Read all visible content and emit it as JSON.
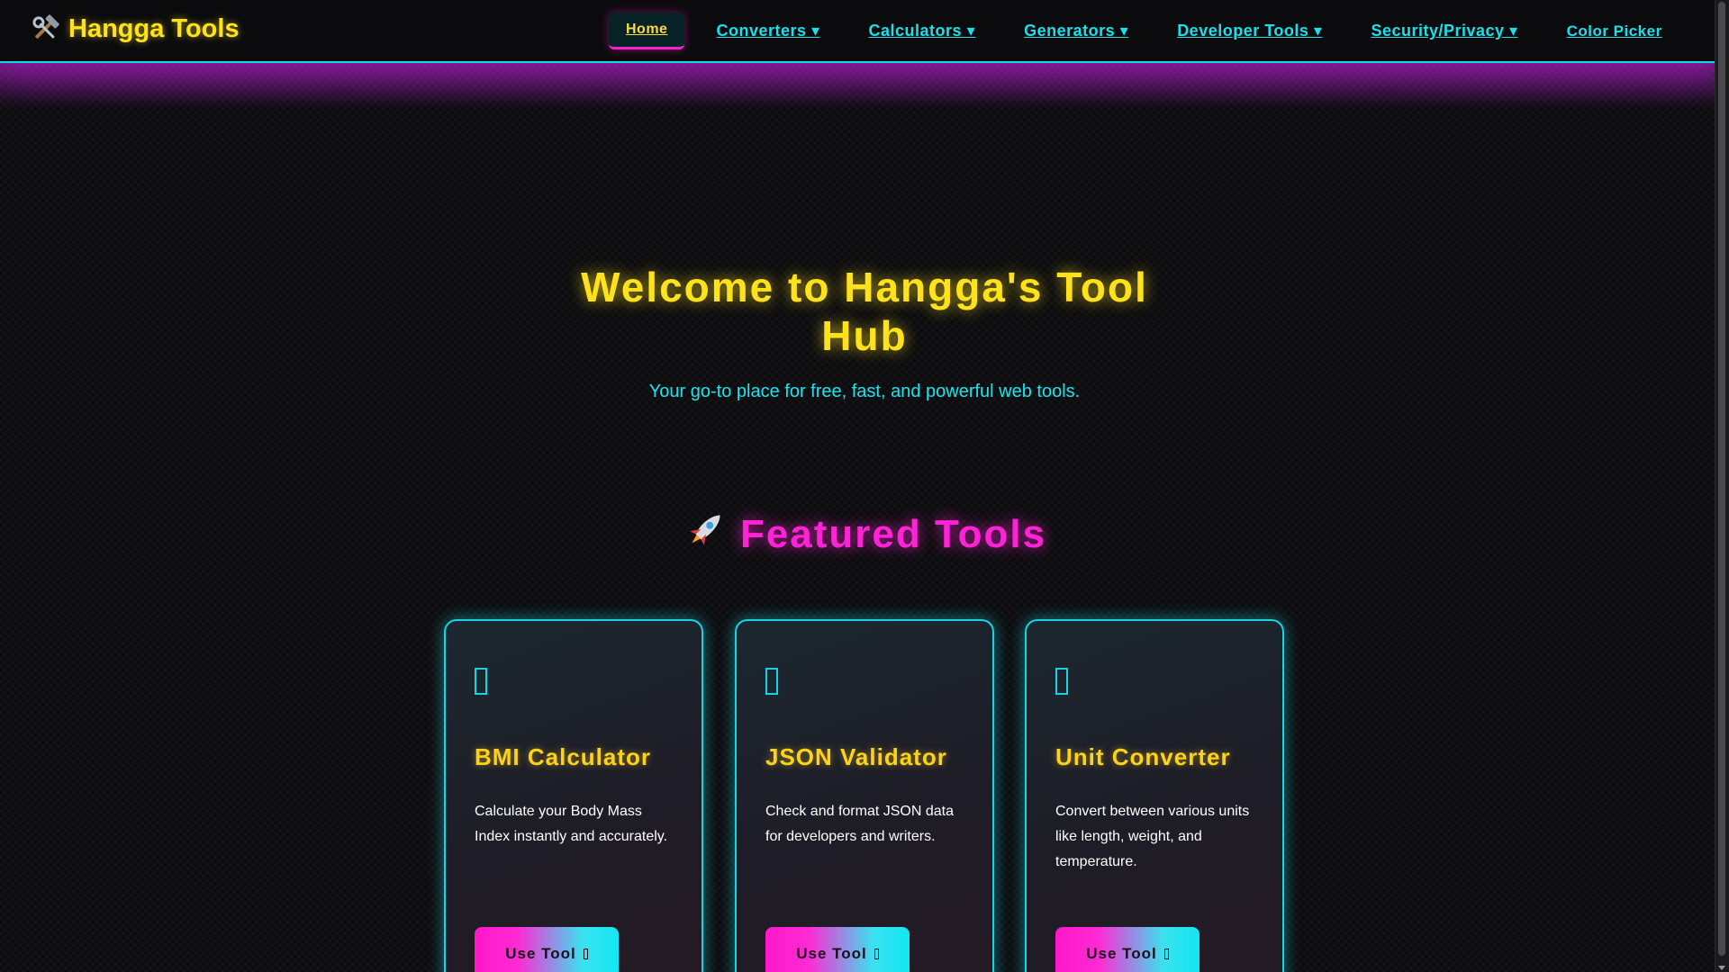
{
  "brand": {
    "icon": "hammer-wrench-icon",
    "name": "Hangga Tools"
  },
  "nav": {
    "home": "Home",
    "converters": "Converters ▾",
    "calculators": "Calculators ▾",
    "generators": "Generators ▾",
    "developer_tools": "Developer Tools ▾",
    "security_privacy": "Security/Privacy ▾",
    "color_picker": "Color Picker"
  },
  "hero": {
    "title": "Welcome to Hangga's Tool Hub",
    "subtitle": "Your go-to place for free, fast, and powerful web tools."
  },
  "featured": {
    "icon": "rocket-icon",
    "title": "Featured Tools"
  },
  "cards": [
    {
      "title": "BMI Calculator",
      "description": "Calculate your Body Mass Index instantly and accurately.",
      "button": "Use Tool"
    },
    {
      "title": "JSON Validator",
      "description": "Check and format JSON data for developers and writers.",
      "button": "Use Tool"
    },
    {
      "title": "Unit Converter",
      "description": "Convert between various units like length, weight, and temperature.",
      "button": "Use Tool"
    }
  ],
  "colors": {
    "accent_yellow": "#ffe21a",
    "accent_cyan": "#18d4e2",
    "accent_magenta": "#ff22d6",
    "background": "#0c0c0e"
  }
}
